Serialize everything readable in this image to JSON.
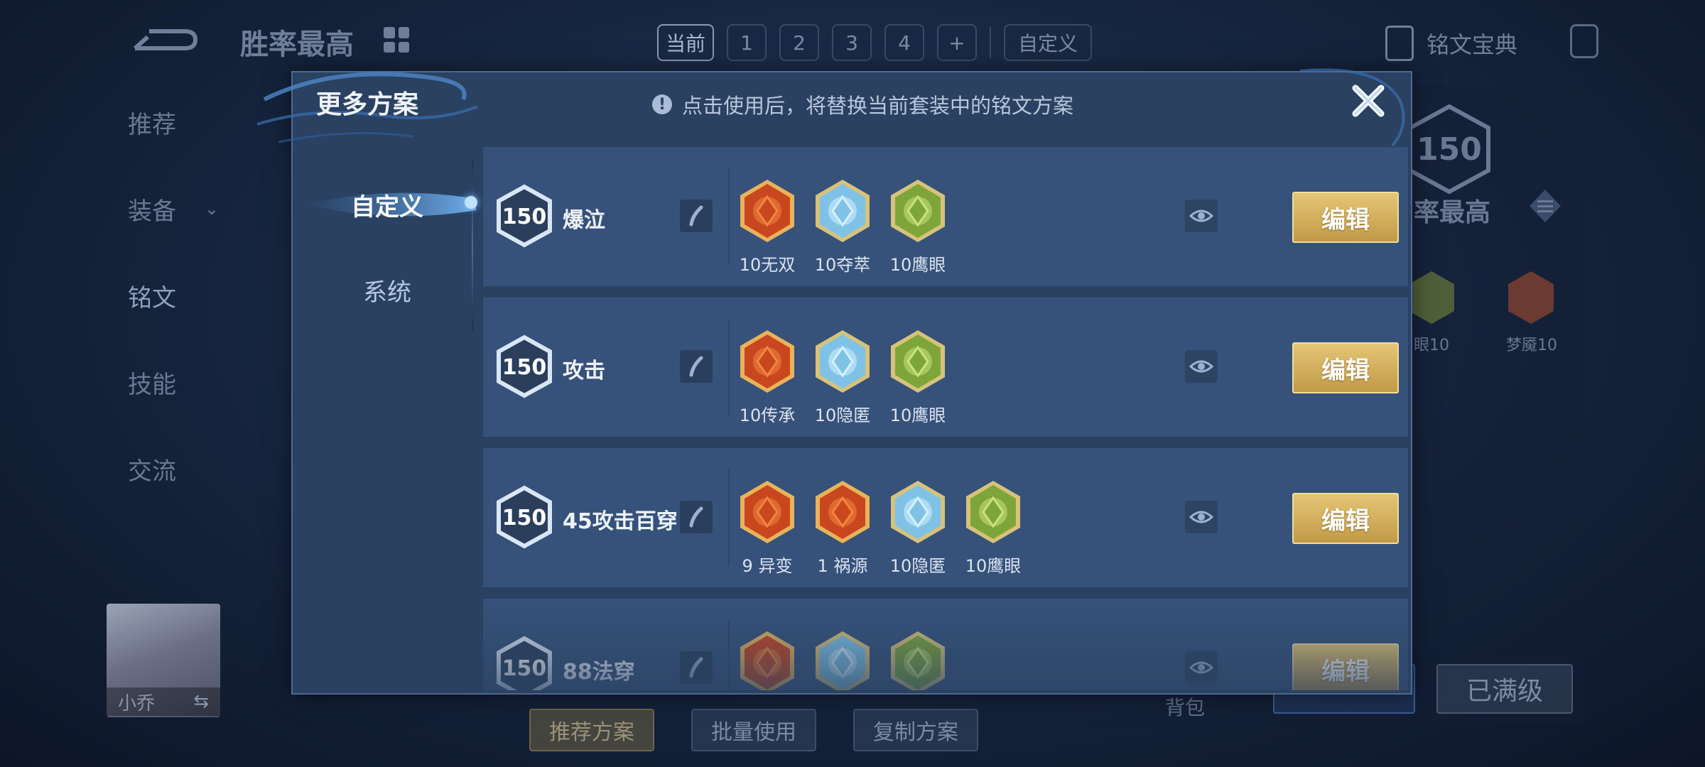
{
  "header": {
    "title": "胜率最高",
    "tabs": [
      "当前",
      "1",
      "2",
      "3",
      "4",
      "+"
    ],
    "custom_tab": "自定义",
    "codex_label": "铭文宝典"
  },
  "side_nav": {
    "items": [
      {
        "label": "推荐"
      },
      {
        "label": "装备"
      },
      {
        "label": "铭文"
      },
      {
        "label": "技能"
      },
      {
        "label": "交流"
      }
    ]
  },
  "background_panel": {
    "level": "150",
    "title_fragment": "率最高",
    "rune_labels": [
      "眼10",
      "梦魇10"
    ],
    "upgrade_label": "已满级"
  },
  "hero": {
    "name": "小乔"
  },
  "bottom_actions": {
    "recommend": "推荐方案",
    "batch_use": "批量使用",
    "copy": "复制方案",
    "bag": "背包"
  },
  "dialog": {
    "title": "更多方案",
    "hint": "点击使用后，将替换当前套装中的铭文方案",
    "tabs": [
      {
        "label": "自定义",
        "active": true
      },
      {
        "label": "系统",
        "active": false
      }
    ],
    "edit_label": "编辑",
    "schemes": [
      {
        "level": "150",
        "name": "爆泣",
        "runes": [
          {
            "label": "10无双",
            "color": "red",
            "icon": "spiral-rune-icon"
          },
          {
            "label": "10夺萃",
            "color": "blue",
            "icon": "knot-rune-icon"
          },
          {
            "label": "10鹰眼",
            "color": "green",
            "icon": "clover-rune-icon"
          }
        ]
      },
      {
        "level": "150",
        "name": "攻击",
        "runes": [
          {
            "label": "10传承",
            "color": "red",
            "icon": "sword-rune-icon"
          },
          {
            "label": "10隐匿",
            "color": "blue",
            "icon": "droplet-rune-icon"
          },
          {
            "label": "10鹰眼",
            "color": "green",
            "icon": "clover-rune-icon"
          }
        ]
      },
      {
        "level": "150",
        "name": "45攻击百穿",
        "runes": [
          {
            "label": "9 异变",
            "color": "red",
            "icon": "arch-rune-icon"
          },
          {
            "label": "1 祸源",
            "color": "red",
            "icon": "claw-rune-icon"
          },
          {
            "label": "10隐匿",
            "color": "blue",
            "icon": "droplet-rune-icon"
          },
          {
            "label": "10鹰眼",
            "color": "green",
            "icon": "clover-rune-icon"
          }
        ]
      },
      {
        "level": "150",
        "name": "88法穿",
        "runes": [
          {
            "label": "",
            "color": "red",
            "icon": "crown-rune-icon"
          },
          {
            "label": "",
            "color": "blue",
            "icon": "star-rune-icon"
          },
          {
            "label": "",
            "color": "green",
            "icon": "leaf-rune-icon"
          }
        ]
      }
    ]
  },
  "colors": {
    "dialog_bg": "#2a4161",
    "row_bg": "#36527a",
    "edit_gold": "#d4b060",
    "rune_red": "#c8471f",
    "rune_blue": "#7fc4e6",
    "rune_green": "#7fa63a"
  }
}
